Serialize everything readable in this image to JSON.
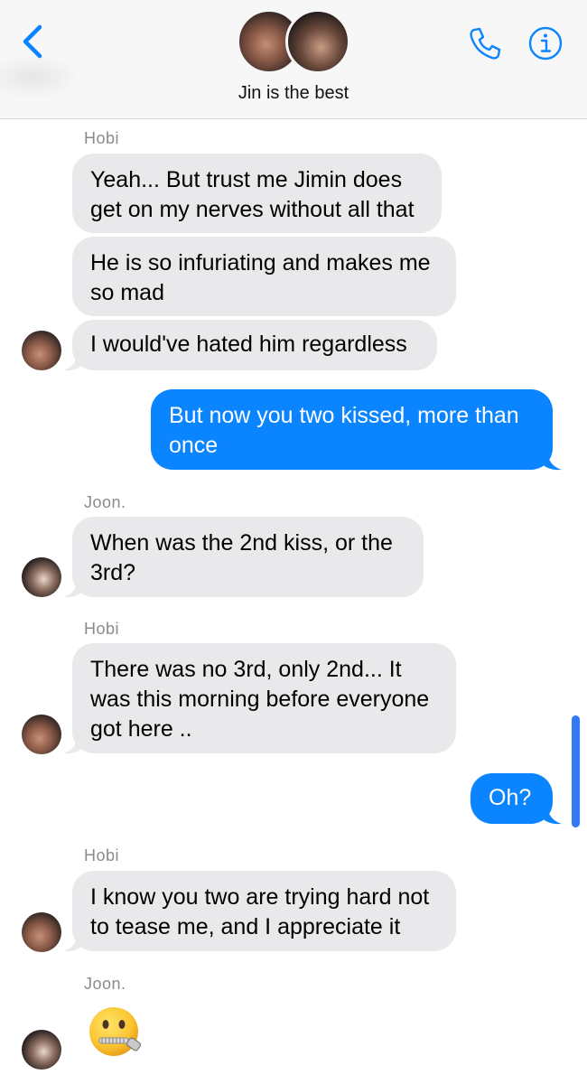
{
  "header": {
    "title": "Jin is the best",
    "back_icon": "chevron-left-icon",
    "phone_icon": "phone-icon",
    "info_icon": "info-icon",
    "accent_color": "#0a84ff"
  },
  "messages": [
    {
      "sender": "Hobi",
      "text": "Yeah... But trust me Jimin does\nget on my nerves without all that"
    },
    {
      "text": "He is so infuriating and makes me\nso mad"
    },
    {
      "text": "I would've hated him regardless"
    },
    {
      "outgoing": true,
      "text": "But now you two kissed, more than\nonce"
    },
    {
      "sender": "Joon.",
      "text": "When was the 2nd kiss, or the\n3rd?"
    },
    {
      "sender": "Hobi",
      "text": "There was no 3rd, only 2nd... It\nwas this morning before everyone\ngot here .."
    },
    {
      "outgoing": true,
      "text": "Oh?"
    },
    {
      "sender": "Hobi",
      "text": "I know you two are trying hard not\nto tease me, and I appreciate it"
    },
    {
      "sender": "Joon.",
      "emoji": "zipper-mouth-face"
    }
  ],
  "colors": {
    "incoming_bubble": "#e9e9eb",
    "outgoing_bubble": "#0a84ff",
    "sender_label": "#8a8a8e"
  }
}
